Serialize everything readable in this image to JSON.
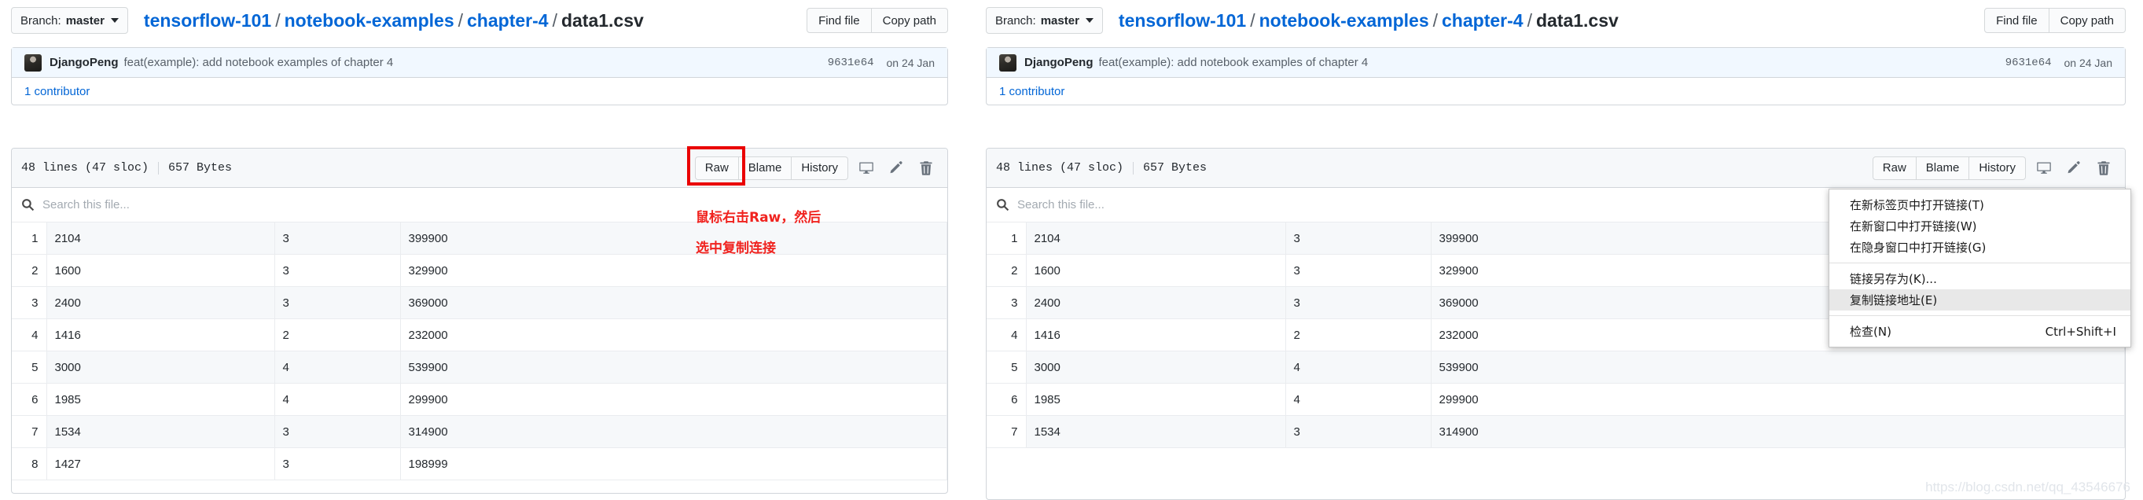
{
  "watermark": "https://blog.csdn.net/qq_43546676",
  "panels": [
    {
      "id": "left",
      "header": {
        "branch_label": "Branch:",
        "branch_name": "master",
        "breadcrumb": {
          "repo": "tensorflow-101",
          "folder1": "notebook-examples",
          "folder2": "chapter-4",
          "file": "data1.csv",
          "separator": "/"
        },
        "find_file_label": "Find file",
        "copy_path_label": "Copy path"
      },
      "commit": {
        "author": "DjangoPeng",
        "message": "feat(example): add notebook examples of chapter 4",
        "sha": "9631e64",
        "date": "on 24 Jan",
        "contributors": "1 contributor"
      },
      "file": {
        "lines": "48 lines (47 sloc)",
        "size": "657 Bytes",
        "raw_label": "Raw",
        "blame_label": "Blame",
        "history_label": "History",
        "search_placeholder": "Search this file...",
        "search_value": ""
      },
      "annotations": {
        "line1": "鼠标右击Raw，然后",
        "line2": "选中复制连接",
        "highlight_color": "#ea0000"
      }
    },
    {
      "id": "right",
      "header": {
        "branch_label": "Branch:",
        "branch_name": "master",
        "breadcrumb": {
          "repo": "tensorflow-101",
          "folder1": "notebook-examples",
          "folder2": "chapter-4",
          "file": "data1.csv",
          "separator": "/"
        },
        "find_file_label": "Find file",
        "copy_path_label": "Copy path"
      },
      "commit": {
        "author": "DjangoPeng",
        "message": "feat(example): add notebook examples of chapter 4",
        "sha": "9631e64",
        "date": "on 24 Jan",
        "contributors": "1 contributor"
      },
      "file": {
        "lines": "48 lines (47 sloc)",
        "size": "657 Bytes",
        "raw_label": "Raw",
        "blame_label": "Blame",
        "history_label": "History",
        "search_placeholder": "Search this file...",
        "search_value": ""
      }
    }
  ],
  "csv": {
    "rows": [
      {
        "n": "1",
        "size": "2104",
        "rooms": "3",
        "price": "399900"
      },
      {
        "n": "2",
        "size": "1600",
        "rooms": "3",
        "price": "329900"
      },
      {
        "n": "3",
        "size": "2400",
        "rooms": "3",
        "price": "369000"
      },
      {
        "n": "4",
        "size": "1416",
        "rooms": "2",
        "price": "232000"
      },
      {
        "n": "5",
        "size": "3000",
        "rooms": "4",
        "price": "539900"
      },
      {
        "n": "6",
        "size": "1985",
        "rooms": "4",
        "price": "299900"
      },
      {
        "n": "7",
        "size": "1534",
        "rooms": "3",
        "price": "314900"
      },
      {
        "n": "8",
        "size": "1427",
        "rooms": "3",
        "price": "198999"
      }
    ]
  },
  "context_menu": {
    "items": [
      {
        "label": "在新标签页中打开链接(T)",
        "accel": "",
        "highlighted": false
      },
      {
        "label": "在新窗口中打开链接(W)",
        "accel": "",
        "highlighted": false
      },
      {
        "label": "在隐身窗口中打开链接(G)",
        "accel": "",
        "highlighted": false
      },
      {
        "separator": true
      },
      {
        "label": "链接另存为(K)...",
        "accel": "",
        "highlighted": false
      },
      {
        "label": "复制链接地址(E)",
        "accel": "",
        "highlighted": true
      },
      {
        "separator": true
      },
      {
        "label": "检查(N)",
        "accel": "Ctrl+Shift+I",
        "highlighted": false
      }
    ]
  }
}
